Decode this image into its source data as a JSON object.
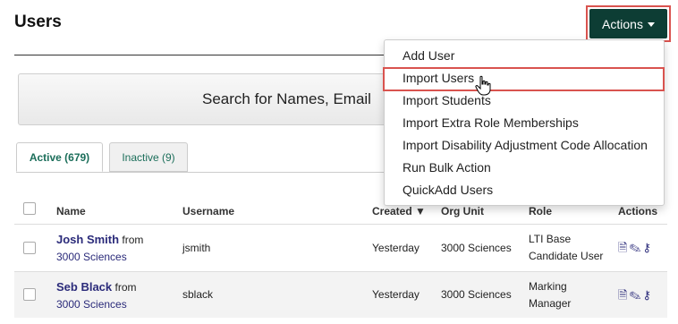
{
  "header": {
    "title": "Users",
    "actions_label": "Actions"
  },
  "search": {
    "label": "Search for Names, Email"
  },
  "tabs": [
    {
      "label": "Active (679)"
    },
    {
      "label": "Inactive (9)"
    }
  ],
  "table": {
    "columns": [
      "Name",
      "Username",
      "Created ▼",
      "Org Unit",
      "Role",
      "Actions"
    ],
    "rows": [
      {
        "name": "Josh Smith",
        "from": "from",
        "org_link": "3000 Sciences",
        "username": "jsmith",
        "created": "Yesterday",
        "org_unit": "3000 Sciences",
        "role_line1": "LTI Base",
        "role_line2": "Candidate User"
      },
      {
        "name": "Seb Black",
        "from": "from",
        "org_link": "3000 Sciences",
        "username": "sblack",
        "created": "Yesterday",
        "org_unit": "3000 Sciences",
        "role_line1": "Marking",
        "role_line2": "Manager"
      }
    ]
  },
  "menu": {
    "items": [
      "Add User",
      "Import Users",
      "Import Students",
      "Import Extra Role Memberships",
      "Import Disability Adjustment Code Allocation",
      "Run Bulk Action",
      "QuickAdd Users"
    ]
  },
  "colors": {
    "accent": "#0d3d34",
    "highlight": "#d9534f",
    "link": "#2b2b7a"
  },
  "icons": [
    "caret-down-icon",
    "document-icon",
    "pencil-icon",
    "key-icon",
    "hand-cursor-icon"
  ]
}
